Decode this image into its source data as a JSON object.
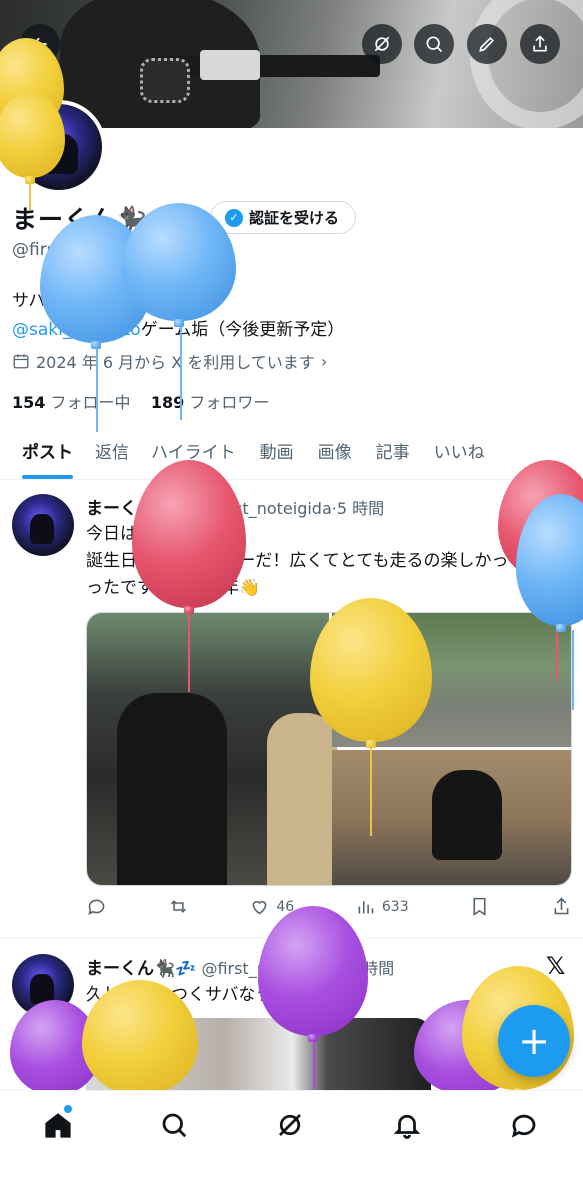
{
  "profile": {
    "name": "まーくん🐈‍⬛💤",
    "verify_label": "認証を受ける",
    "handle": "@first_noteigida",
    "bio_line1": "サバゲー初 2024 年 3 月",
    "bio_link": "@saki_virakuto",
    "bio_line2_rest": "ゲーム垢（今後更新予定）",
    "joined": "2024 年 6 月から X を利用しています",
    "following_count": "154",
    "following_label": "フォロー中",
    "followers_count": "189",
    "followers_label": "フォロワー"
  },
  "top_icons": [
    "back-icon",
    "grok-icon",
    "search-icon",
    "edit-icon",
    "share-icon"
  ],
  "tabs": [
    "ポスト",
    "返信",
    "ハイライト",
    "動画",
    "画像",
    "記事",
    "いいね"
  ],
  "tweets": [
    {
      "name": "まーくん🐈‍⬛💤",
      "handle": "@first_noteigida",
      "time": "5 時間",
      "text_line1": "今日はつくサバ！",
      "text_line2": "誕生日の前日サバゲーだ！広くてとても走るの楽しかっ",
      "text_line3": "ったです！また来年👋",
      "likes": "46",
      "views": "633"
    },
    {
      "name": "まーくん🐈‍⬛💤",
      "handle": "@first_noteigida",
      "time": "13 時間",
      "text_line1": "久しぶりのつくサバなう5連休〜"
    }
  ],
  "x_logo": "𝕏",
  "fab_label": "+",
  "bottom_nav": [
    "home-icon",
    "search-icon",
    "grok-icon",
    "notifications-icon",
    "messages-icon"
  ],
  "colors": {
    "accent": "#1d9bf0",
    "text": "#0f1419",
    "secondary": "#536471"
  }
}
